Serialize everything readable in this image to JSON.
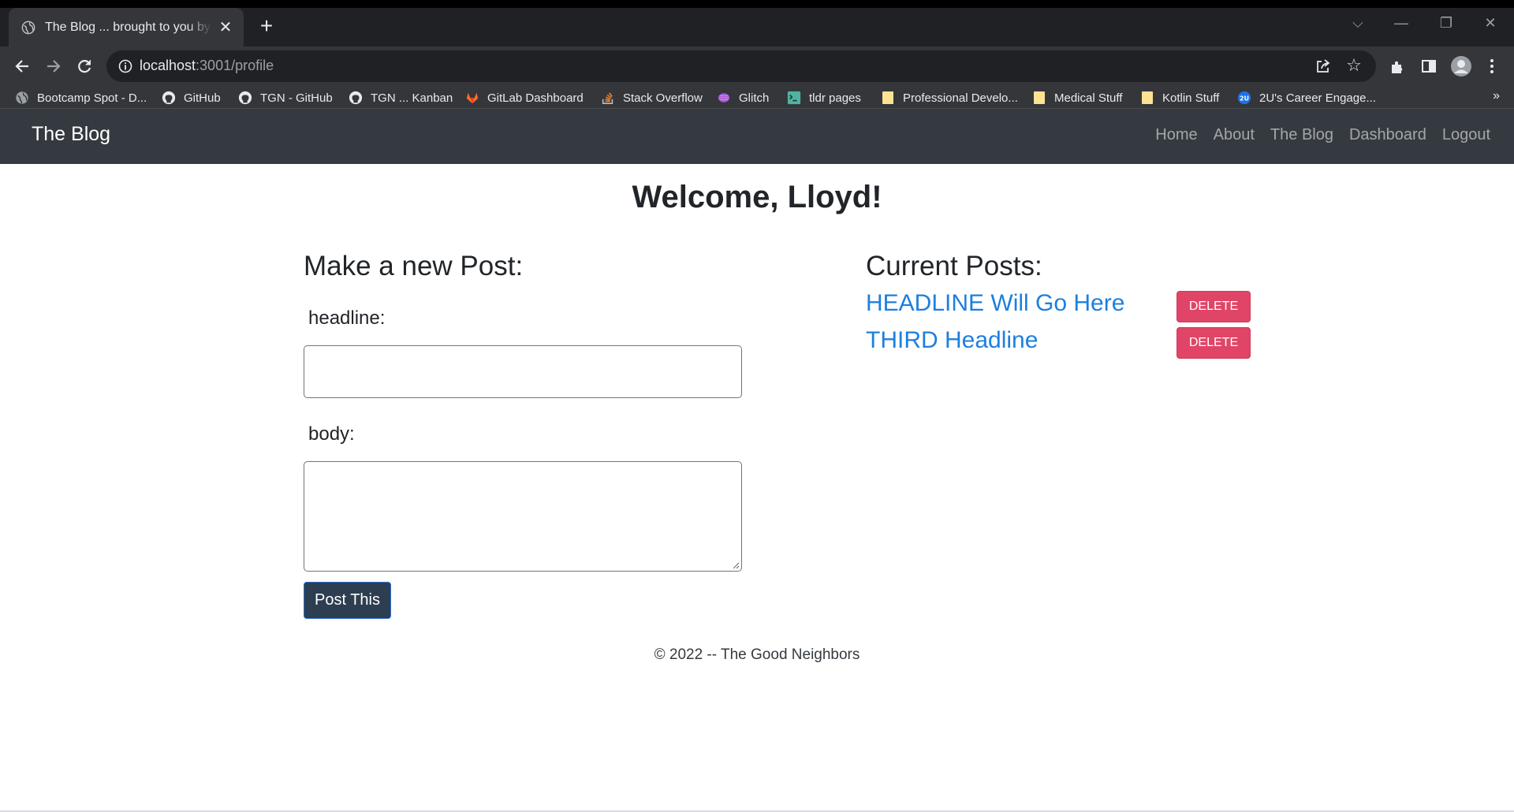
{
  "browser": {
    "tab": {
      "title": "The Blog ... brought to you by the Good Neighbors",
      "close": "✕"
    },
    "new_tab": "+",
    "address": {
      "host": "localhost",
      "path": ":3001/profile"
    },
    "bookmarks": [
      {
        "label": "Bootcamp Spot - D...",
        "icon": "globe-icon"
      },
      {
        "label": "GitHub",
        "icon": "github-icon"
      },
      {
        "label": "TGN - GitHub",
        "icon": "github-icon"
      },
      {
        "label": "TGN ... Kanban",
        "icon": "github-icon"
      },
      {
        "label": "GitLab Dashboard",
        "icon": "gitlab-icon"
      },
      {
        "label": "Stack Overflow",
        "icon": "stackoverflow-icon"
      },
      {
        "label": "Glitch",
        "icon": "glitch-icon"
      },
      {
        "label": "tldr pages",
        "icon": "tldr-icon"
      },
      {
        "label": "Professional Develo...",
        "icon": "folder-icon"
      },
      {
        "label": "Medical Stuff",
        "icon": "folder-icon"
      },
      {
        "label": "Kotlin Stuff",
        "icon": "folder-icon"
      },
      {
        "label": "2U's Career Engage...",
        "icon": "2u-icon"
      }
    ],
    "bookmarks_more": "»"
  },
  "site": {
    "brand": "The Blog",
    "nav": [
      "Home",
      "About",
      "The Blog",
      "Dashboard",
      "Logout"
    ]
  },
  "main": {
    "welcome": "Welcome, Lloyd!",
    "new_post": {
      "heading": "Make a new Post:",
      "headline_label": "headline:",
      "headline_value": "",
      "body_label": "body:",
      "body_value": "",
      "submit": "Post This"
    },
    "current_posts": {
      "heading": "Current Posts:",
      "posts": [
        {
          "title": "HEADLINE Will Go Here",
          "action": "DELETE"
        },
        {
          "title": "THIRD Headline",
          "action": "DELETE"
        }
      ]
    },
    "footer": "© 2022 -- The Good Neighbors"
  },
  "colors": {
    "navbar": "#343a40",
    "link": "#1d7fe0",
    "delete": "#e04567",
    "submit": "#2c3e50"
  }
}
